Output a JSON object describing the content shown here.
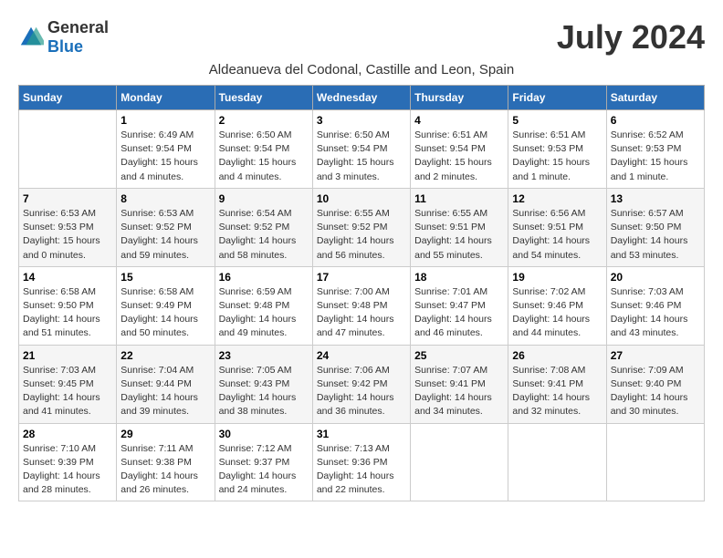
{
  "header": {
    "logo_general": "General",
    "logo_blue": "Blue",
    "month_title": "July 2024",
    "subtitle": "Aldeanueva del Codonal, Castille and Leon, Spain"
  },
  "weekdays": [
    "Sunday",
    "Monday",
    "Tuesday",
    "Wednesday",
    "Thursday",
    "Friday",
    "Saturday"
  ],
  "weeks": [
    [
      {
        "day": "",
        "sunrise": "",
        "sunset": "",
        "daylight": ""
      },
      {
        "day": "1",
        "sunrise": "Sunrise: 6:49 AM",
        "sunset": "Sunset: 9:54 PM",
        "daylight": "Daylight: 15 hours and 4 minutes."
      },
      {
        "day": "2",
        "sunrise": "Sunrise: 6:50 AM",
        "sunset": "Sunset: 9:54 PM",
        "daylight": "Daylight: 15 hours and 4 minutes."
      },
      {
        "day": "3",
        "sunrise": "Sunrise: 6:50 AM",
        "sunset": "Sunset: 9:54 PM",
        "daylight": "Daylight: 15 hours and 3 minutes."
      },
      {
        "day": "4",
        "sunrise": "Sunrise: 6:51 AM",
        "sunset": "Sunset: 9:54 PM",
        "daylight": "Daylight: 15 hours and 2 minutes."
      },
      {
        "day": "5",
        "sunrise": "Sunrise: 6:51 AM",
        "sunset": "Sunset: 9:53 PM",
        "daylight": "Daylight: 15 hours and 1 minute."
      },
      {
        "day": "6",
        "sunrise": "Sunrise: 6:52 AM",
        "sunset": "Sunset: 9:53 PM",
        "daylight": "Daylight: 15 hours and 1 minute."
      }
    ],
    [
      {
        "day": "7",
        "sunrise": "Sunrise: 6:53 AM",
        "sunset": "Sunset: 9:53 PM",
        "daylight": "Daylight: 15 hours and 0 minutes."
      },
      {
        "day": "8",
        "sunrise": "Sunrise: 6:53 AM",
        "sunset": "Sunset: 9:52 PM",
        "daylight": "Daylight: 14 hours and 59 minutes."
      },
      {
        "day": "9",
        "sunrise": "Sunrise: 6:54 AM",
        "sunset": "Sunset: 9:52 PM",
        "daylight": "Daylight: 14 hours and 58 minutes."
      },
      {
        "day": "10",
        "sunrise": "Sunrise: 6:55 AM",
        "sunset": "Sunset: 9:52 PM",
        "daylight": "Daylight: 14 hours and 56 minutes."
      },
      {
        "day": "11",
        "sunrise": "Sunrise: 6:55 AM",
        "sunset": "Sunset: 9:51 PM",
        "daylight": "Daylight: 14 hours and 55 minutes."
      },
      {
        "day": "12",
        "sunrise": "Sunrise: 6:56 AM",
        "sunset": "Sunset: 9:51 PM",
        "daylight": "Daylight: 14 hours and 54 minutes."
      },
      {
        "day": "13",
        "sunrise": "Sunrise: 6:57 AM",
        "sunset": "Sunset: 9:50 PM",
        "daylight": "Daylight: 14 hours and 53 minutes."
      }
    ],
    [
      {
        "day": "14",
        "sunrise": "Sunrise: 6:58 AM",
        "sunset": "Sunset: 9:50 PM",
        "daylight": "Daylight: 14 hours and 51 minutes."
      },
      {
        "day": "15",
        "sunrise": "Sunrise: 6:58 AM",
        "sunset": "Sunset: 9:49 PM",
        "daylight": "Daylight: 14 hours and 50 minutes."
      },
      {
        "day": "16",
        "sunrise": "Sunrise: 6:59 AM",
        "sunset": "Sunset: 9:48 PM",
        "daylight": "Daylight: 14 hours and 49 minutes."
      },
      {
        "day": "17",
        "sunrise": "Sunrise: 7:00 AM",
        "sunset": "Sunset: 9:48 PM",
        "daylight": "Daylight: 14 hours and 47 minutes."
      },
      {
        "day": "18",
        "sunrise": "Sunrise: 7:01 AM",
        "sunset": "Sunset: 9:47 PM",
        "daylight": "Daylight: 14 hours and 46 minutes."
      },
      {
        "day": "19",
        "sunrise": "Sunrise: 7:02 AM",
        "sunset": "Sunset: 9:46 PM",
        "daylight": "Daylight: 14 hours and 44 minutes."
      },
      {
        "day": "20",
        "sunrise": "Sunrise: 7:03 AM",
        "sunset": "Sunset: 9:46 PM",
        "daylight": "Daylight: 14 hours and 43 minutes."
      }
    ],
    [
      {
        "day": "21",
        "sunrise": "Sunrise: 7:03 AM",
        "sunset": "Sunset: 9:45 PM",
        "daylight": "Daylight: 14 hours and 41 minutes."
      },
      {
        "day": "22",
        "sunrise": "Sunrise: 7:04 AM",
        "sunset": "Sunset: 9:44 PM",
        "daylight": "Daylight: 14 hours and 39 minutes."
      },
      {
        "day": "23",
        "sunrise": "Sunrise: 7:05 AM",
        "sunset": "Sunset: 9:43 PM",
        "daylight": "Daylight: 14 hours and 38 minutes."
      },
      {
        "day": "24",
        "sunrise": "Sunrise: 7:06 AM",
        "sunset": "Sunset: 9:42 PM",
        "daylight": "Daylight: 14 hours and 36 minutes."
      },
      {
        "day": "25",
        "sunrise": "Sunrise: 7:07 AM",
        "sunset": "Sunset: 9:41 PM",
        "daylight": "Daylight: 14 hours and 34 minutes."
      },
      {
        "day": "26",
        "sunrise": "Sunrise: 7:08 AM",
        "sunset": "Sunset: 9:41 PM",
        "daylight": "Daylight: 14 hours and 32 minutes."
      },
      {
        "day": "27",
        "sunrise": "Sunrise: 7:09 AM",
        "sunset": "Sunset: 9:40 PM",
        "daylight": "Daylight: 14 hours and 30 minutes."
      }
    ],
    [
      {
        "day": "28",
        "sunrise": "Sunrise: 7:10 AM",
        "sunset": "Sunset: 9:39 PM",
        "daylight": "Daylight: 14 hours and 28 minutes."
      },
      {
        "day": "29",
        "sunrise": "Sunrise: 7:11 AM",
        "sunset": "Sunset: 9:38 PM",
        "daylight": "Daylight: 14 hours and 26 minutes."
      },
      {
        "day": "30",
        "sunrise": "Sunrise: 7:12 AM",
        "sunset": "Sunset: 9:37 PM",
        "daylight": "Daylight: 14 hours and 24 minutes."
      },
      {
        "day": "31",
        "sunrise": "Sunrise: 7:13 AM",
        "sunset": "Sunset: 9:36 PM",
        "daylight": "Daylight: 14 hours and 22 minutes."
      },
      {
        "day": "",
        "sunrise": "",
        "sunset": "",
        "daylight": ""
      },
      {
        "day": "",
        "sunrise": "",
        "sunset": "",
        "daylight": ""
      },
      {
        "day": "",
        "sunrise": "",
        "sunset": "",
        "daylight": ""
      }
    ]
  ]
}
